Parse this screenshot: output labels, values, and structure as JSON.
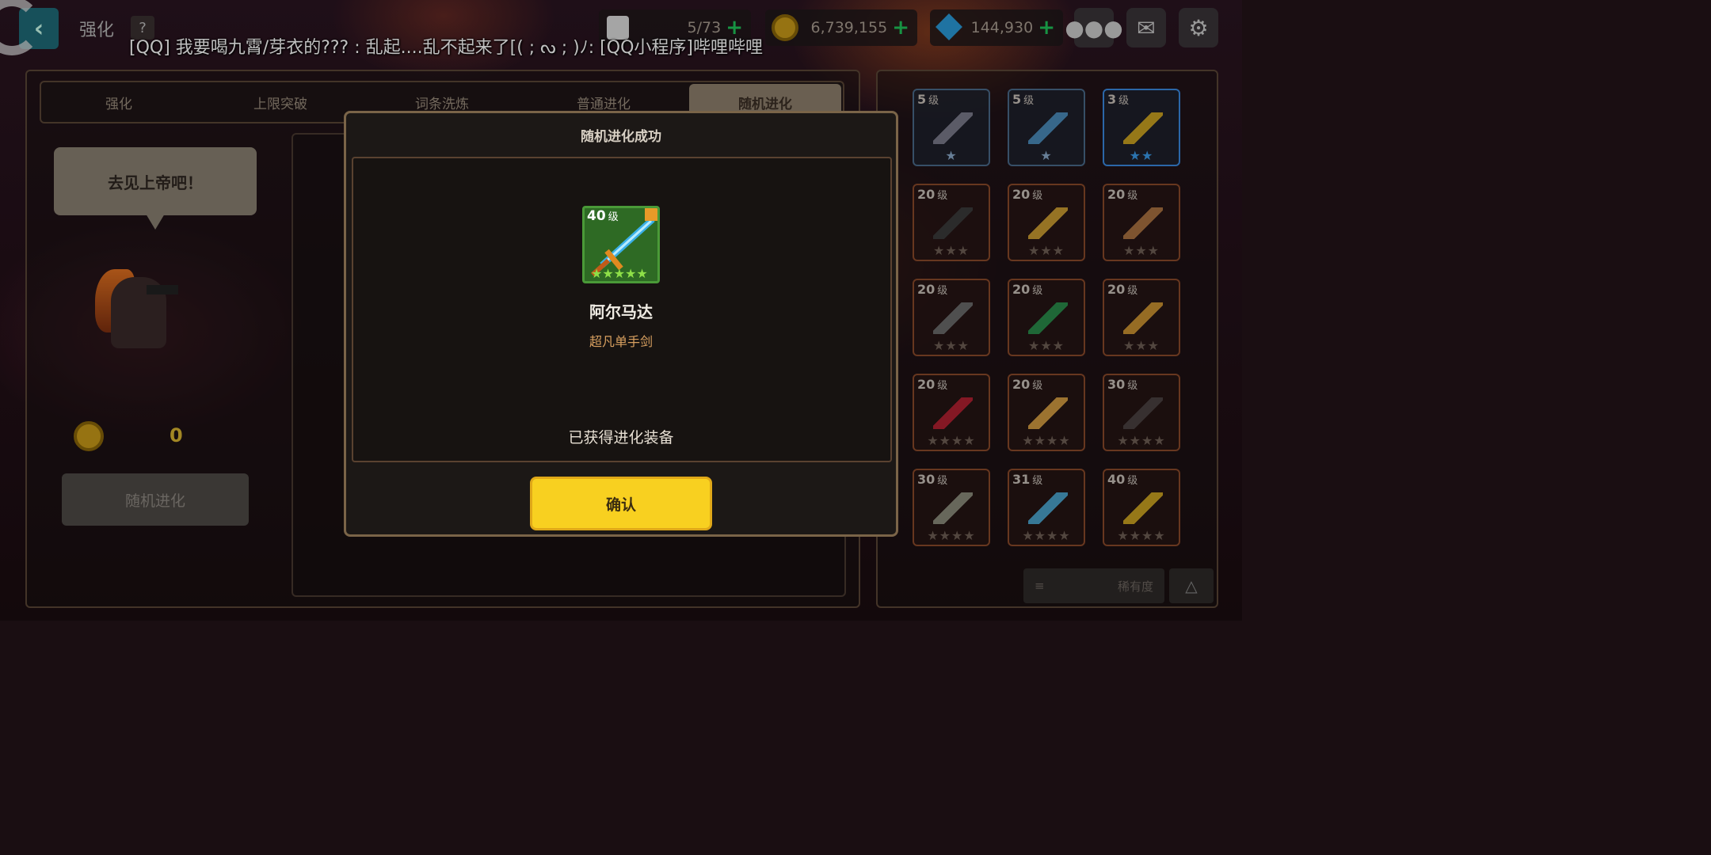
{
  "top": {
    "back_icon": "chevron-left-icon",
    "title": "强化",
    "help": "?",
    "marquee": "[QQ] 我要喝九霄/芽衣的??? : 乱起....乱不起来了[( ; ᔓ ; )ﾉ: [QQ小程序]哔哩哔哩",
    "energy": "5/73",
    "gold": "6,739,155",
    "gems": "144,930",
    "plus": "+"
  },
  "tabs": [
    "强化",
    "上限突破",
    "词条洗炼",
    "普通进化",
    "随机进化"
  ],
  "left": {
    "speech": "去见上帝吧！",
    "cost": "0",
    "evolve_button": "随机进化"
  },
  "inventory": [
    {
      "level": "5",
      "unit": "级",
      "stars": "★",
      "style": "blue"
    },
    {
      "level": "5",
      "unit": "级",
      "stars": "★",
      "style": "blue"
    },
    {
      "level": "3",
      "unit": "级",
      "stars": "★★",
      "style": "bright"
    },
    {
      "level": "20",
      "unit": "级",
      "stars": "★★★",
      "style": "red"
    },
    {
      "level": "20",
      "unit": "级",
      "stars": "★★★",
      "style": "red"
    },
    {
      "level": "20",
      "unit": "级",
      "stars": "★★★",
      "style": "red"
    },
    {
      "level": "20",
      "unit": "级",
      "stars": "★★★",
      "style": "red"
    },
    {
      "level": "20",
      "unit": "级",
      "stars": "★★★",
      "style": "red"
    },
    {
      "level": "20",
      "unit": "级",
      "stars": "★★★",
      "style": "red"
    },
    {
      "level": "20",
      "unit": "级",
      "stars": "★★★★",
      "style": "red"
    },
    {
      "level": "20",
      "unit": "级",
      "stars": "★★★★",
      "style": "red"
    },
    {
      "level": "30",
      "unit": "级",
      "stars": "★★★★",
      "style": "red"
    },
    {
      "level": "30",
      "unit": "级",
      "stars": "★★★★",
      "style": "red"
    },
    {
      "level": "31",
      "unit": "级",
      "stars": "★★★★",
      "style": "red"
    },
    {
      "level": "40",
      "unit": "级",
      "stars": "★★★★",
      "style": "red"
    }
  ],
  "sort": {
    "label": "稀有度",
    "icon": "list-icon",
    "toggle_icon": "triangle-up-icon"
  },
  "modal": {
    "title": "随机进化成功",
    "item_level": "40",
    "item_level_unit": "级",
    "item_stars": "★★★★★",
    "item_name": "阿尔马达",
    "item_type": "超凡单手剑",
    "obtained": "已获得进化装备",
    "confirm": "确认"
  }
}
